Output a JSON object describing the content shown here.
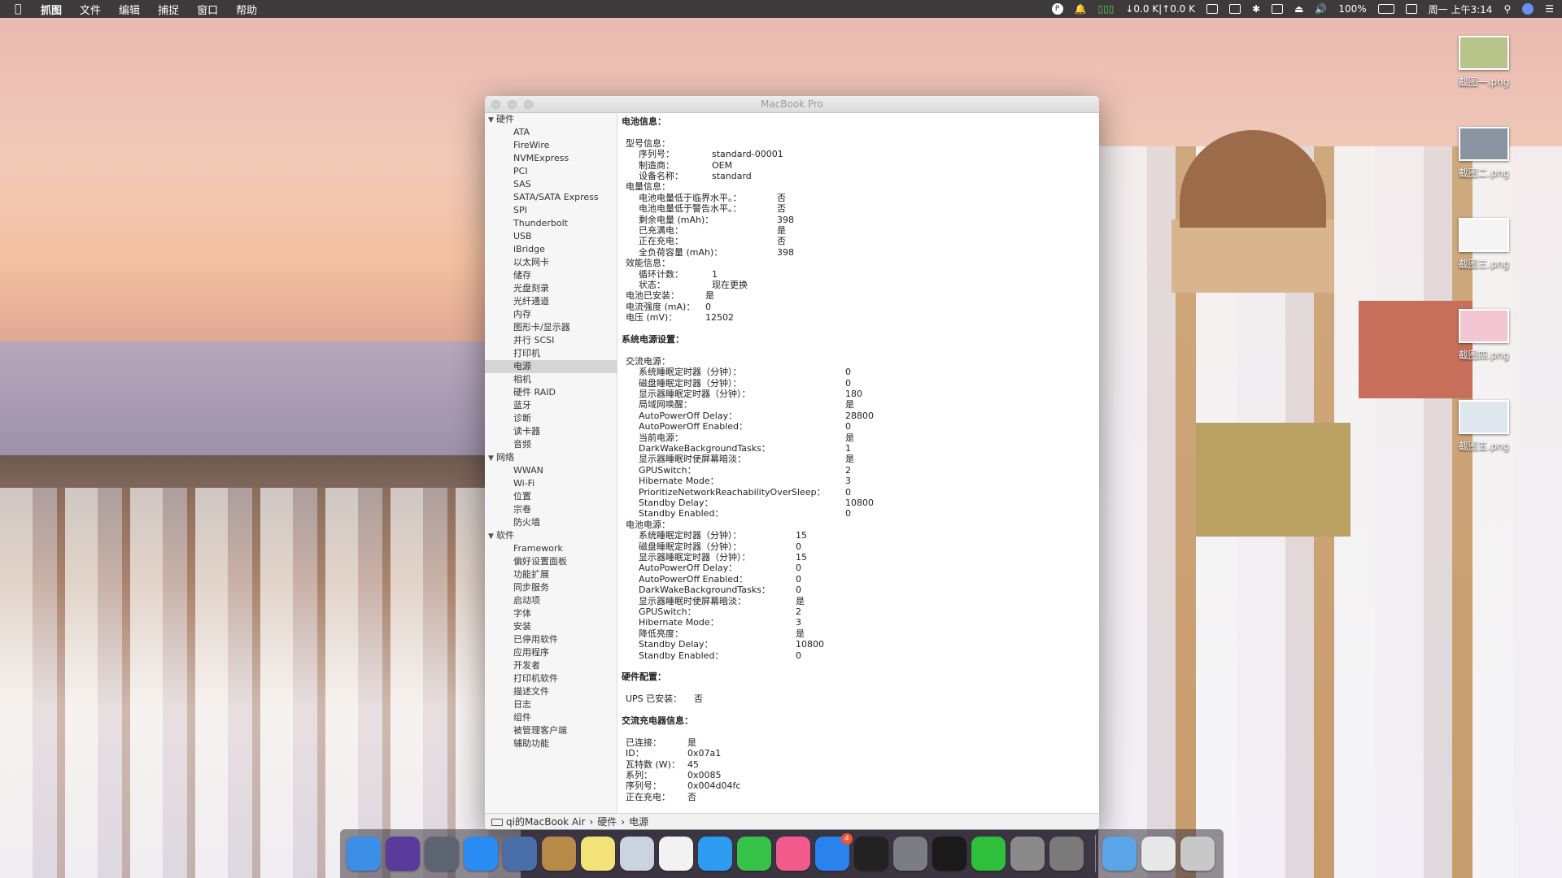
{
  "menubar": {
    "apple_icon": "apple-icon",
    "items": [
      "抓图",
      "文件",
      "编辑",
      "捕捉",
      "窗口",
      "帮助"
    ],
    "network_speed": "↓0.0 K|↑0.0 K",
    "battery": "100%",
    "clock": "周一 上午3:14"
  },
  "desktop_files": [
    "截图一.png",
    "截图二.png",
    "截图三.png",
    "截图四.png",
    "截图五.png"
  ],
  "window": {
    "title": "MacBook Pro",
    "sidebar": {
      "categories": [
        {
          "label": "硬件",
          "items": [
            "ATA",
            "FireWire",
            "NVMExpress",
            "PCI",
            "SAS",
            "SATA/SATA Express",
            "SPI",
            "Thunderbolt",
            "USB",
            "iBridge",
            "以太网卡",
            "储存",
            "光盘刻录",
            "光纤通道",
            "内存",
            "图形卡/显示器",
            "并行 SCSI",
            "打印机",
            "电源",
            "相机",
            "硬件 RAID",
            "蓝牙",
            "诊断",
            "读卡器",
            "音频"
          ]
        },
        {
          "label": "网络",
          "items": [
            "WWAN",
            "Wi-Fi",
            "位置",
            "宗卷",
            "防火墙"
          ]
        },
        {
          "label": "软件",
          "items": [
            "Framework",
            "偏好设置面板",
            "功能扩展",
            "同步服务",
            "启动项",
            "字体",
            "安装",
            "已停用软件",
            "应用程序",
            "开发者",
            "打印机软件",
            "描述文件",
            "日志",
            "组件",
            "被管理客户端",
            "辅助功能"
          ]
        }
      ],
      "selected": "电源"
    },
    "content": [
      {
        "t": "电池信息：",
        "v": "",
        "indent": 0,
        "bold": true
      },
      {
        "t": "",
        "v": "",
        "indent": 0
      },
      {
        "t": "型号信息：",
        "v": "",
        "indent": 1
      },
      {
        "t": "序列号：",
        "v": "standard-00001",
        "indent": 2,
        "col": 90
      },
      {
        "t": "制造商：",
        "v": "OEM",
        "indent": 2,
        "col": 90
      },
      {
        "t": "设备名称：",
        "v": "standard",
        "indent": 2,
        "col": 90
      },
      {
        "t": "电量信息：",
        "v": "",
        "indent": 1
      },
      {
        "t": "电池电量低于临界水平。：",
        "v": "否",
        "indent": 2,
        "col": 170
      },
      {
        "t": "电池电量低于警告水平。：",
        "v": "否",
        "indent": 2,
        "col": 170
      },
      {
        "t": "剩余电量 (mAh)：",
        "v": "398",
        "indent": 2,
        "col": 170
      },
      {
        "t": "已充满电：",
        "v": "是",
        "indent": 2,
        "col": 170
      },
      {
        "t": "正在充电：",
        "v": "否",
        "indent": 2,
        "col": 170
      },
      {
        "t": "全负荷容量 (mAh)：",
        "v": "398",
        "indent": 2,
        "col": 170
      },
      {
        "t": "效能信息：",
        "v": "",
        "indent": 1
      },
      {
        "t": "循环计数：",
        "v": "1",
        "indent": 2,
        "col": 90
      },
      {
        "t": "状态：",
        "v": "现在更换",
        "indent": 2,
        "col": 90
      },
      {
        "t": "电池已安装：",
        "v": "是",
        "indent": 1,
        "col": 98
      },
      {
        "t": "电流强度 (mA)：",
        "v": "0",
        "indent": 1,
        "col": 98
      },
      {
        "t": "电压 (mV)：",
        "v": "12502",
        "indent": 1,
        "col": 98
      },
      {
        "t": "",
        "v": "",
        "indent": 0
      },
      {
        "t": "系统电源设置：",
        "v": "",
        "indent": 0,
        "bold": true
      },
      {
        "t": "",
        "v": "",
        "indent": 0
      },
      {
        "t": "交流电源：",
        "v": "",
        "indent": 1
      },
      {
        "t": "系统睡眠定时器（分钟）：",
        "v": "0",
        "indent": 2,
        "col": 254
      },
      {
        "t": "磁盘睡眠定时器（分钟）：",
        "v": "0",
        "indent": 2,
        "col": 254
      },
      {
        "t": "显示器睡眠定时器（分钟）：",
        "v": "180",
        "indent": 2,
        "col": 254
      },
      {
        "t": "局域网唤醒：",
        "v": "是",
        "indent": 2,
        "col": 254
      },
      {
        "t": "AutoPowerOff Delay：",
        "v": "28800",
        "indent": 2,
        "col": 254
      },
      {
        "t": "AutoPowerOff Enabled：",
        "v": "0",
        "indent": 2,
        "col": 254
      },
      {
        "t": "当前电源：",
        "v": "是",
        "indent": 2,
        "col": 254
      },
      {
        "t": "DarkWakeBackgroundTasks：",
        "v": "1",
        "indent": 2,
        "col": 254
      },
      {
        "t": "显示器睡眠时使屏幕暗淡：",
        "v": "是",
        "indent": 2,
        "col": 254
      },
      {
        "t": "GPUSwitch：",
        "v": "2",
        "indent": 2,
        "col": 254
      },
      {
        "t": "Hibernate Mode：",
        "v": "3",
        "indent": 2,
        "col": 254
      },
      {
        "t": "PrioritizeNetworkReachabilityOverSleep：",
        "v": "0",
        "indent": 2,
        "col": 254
      },
      {
        "t": "Standby Delay：",
        "v": "10800",
        "indent": 2,
        "col": 254
      },
      {
        "t": "Standby Enabled：",
        "v": "0",
        "indent": 2,
        "col": 254
      },
      {
        "t": "电池电源：",
        "v": "",
        "indent": 1
      },
      {
        "t": "系统睡眠定时器（分钟）：",
        "v": "15",
        "indent": 2,
        "col": 193
      },
      {
        "t": "磁盘睡眠定时器（分钟）：",
        "v": "0",
        "indent": 2,
        "col": 193
      },
      {
        "t": "显示器睡眠定时器（分钟）：",
        "v": "15",
        "indent": 2,
        "col": 193
      },
      {
        "t": "AutoPowerOff Delay：",
        "v": "0",
        "indent": 2,
        "col": 193
      },
      {
        "t": "AutoPowerOff Enabled：",
        "v": "0",
        "indent": 2,
        "col": 193
      },
      {
        "t": "DarkWakeBackgroundTasks：",
        "v": "0",
        "indent": 2,
        "col": 193
      },
      {
        "t": "显示器睡眠时使屏幕暗淡：",
        "v": "是",
        "indent": 2,
        "col": 193
      },
      {
        "t": "GPUSwitch：",
        "v": "2",
        "indent": 2,
        "col": 193
      },
      {
        "t": "Hibernate Mode：",
        "v": "3",
        "indent": 2,
        "col": 193
      },
      {
        "t": "降低亮度：",
        "v": "是",
        "indent": 2,
        "col": 193
      },
      {
        "t": "Standby Delay：",
        "v": "10800",
        "indent": 2,
        "col": 193
      },
      {
        "t": "Standby Enabled：",
        "v": "0",
        "indent": 2,
        "col": 193
      },
      {
        "t": "",
        "v": "",
        "indent": 0
      },
      {
        "t": "硬件配置：",
        "v": "",
        "indent": 0,
        "bold": true
      },
      {
        "t": "",
        "v": "",
        "indent": 0
      },
      {
        "t": "UPS 已安装：",
        "v": "否",
        "indent": 1,
        "col": 84
      },
      {
        "t": "",
        "v": "",
        "indent": 0
      },
      {
        "t": "交流充电器信息：",
        "v": "",
        "indent": 0,
        "bold": true
      },
      {
        "t": "",
        "v": "",
        "indent": 0
      },
      {
        "t": "已连接：",
        "v": "是",
        "indent": 1,
        "col": 76
      },
      {
        "t": "ID：",
        "v": "0x07a1",
        "indent": 1,
        "col": 76
      },
      {
        "t": "瓦特数 (W)：",
        "v": "45",
        "indent": 1,
        "col": 76
      },
      {
        "t": "系列：",
        "v": "0x0085",
        "indent": 1,
        "col": 76
      },
      {
        "t": "序列号：",
        "v": "0x004d04fc",
        "indent": 1,
        "col": 76
      },
      {
        "t": "正在充电：",
        "v": "否",
        "indent": 1,
        "col": 76
      }
    ],
    "statusbar": {
      "computer": "qi的MacBook Air",
      "sep": "›",
      "level1": "硬件",
      "level2": "电源"
    }
  },
  "dock": {
    "apps": [
      {
        "name": "finder",
        "color": "#3d8ee6"
      },
      {
        "name": "siri",
        "color": "#5a3b9c"
      },
      {
        "name": "launchpad",
        "color": "#5b6470"
      },
      {
        "name": "safari",
        "color": "#2a8bf2"
      },
      {
        "name": "screenshot-app",
        "color": "#4a6fa8"
      },
      {
        "name": "contacts",
        "color": "#b88a4a"
      },
      {
        "name": "notes",
        "color": "#f3e27a"
      },
      {
        "name": "preview",
        "color": "#c9d4e0"
      },
      {
        "name": "photos",
        "color": "#f2f2f2"
      },
      {
        "name": "messages",
        "color": "#2d9bf0"
      },
      {
        "name": "facetime",
        "color": "#37c24a"
      },
      {
        "name": "itunes",
        "color": "#f15a8a"
      },
      {
        "name": "app-store",
        "color": "#2a82ee",
        "badge": "4"
      },
      {
        "name": "activity-monitor",
        "color": "#222"
      },
      {
        "name": "system-preferences",
        "color": "#7c7c84"
      },
      {
        "name": "qq",
        "color": "#1a1a1a"
      },
      {
        "name": "wechat",
        "color": "#2fbf3b"
      },
      {
        "name": "system-information",
        "color": "#8a8a8a"
      },
      {
        "name": "grapher",
        "color": "#7a7a7a"
      }
    ],
    "right": [
      {
        "name": "applications-folder",
        "color": "#5aa5e8"
      },
      {
        "name": "downloads-stack",
        "color": "#e8e8e8"
      },
      {
        "name": "trash",
        "color": "#c8c8c8"
      }
    ]
  }
}
